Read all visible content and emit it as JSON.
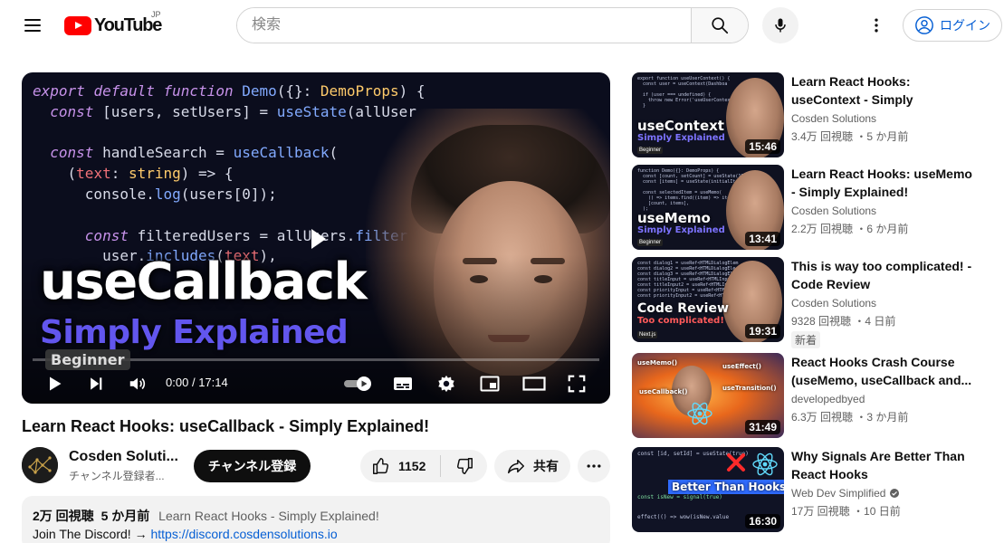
{
  "header": {
    "logo_text": "YouTube",
    "region": "JP",
    "search_placeholder": "検索",
    "login_label": "ログイン"
  },
  "player": {
    "thumbnail_title": "useCallback",
    "thumbnail_subtitle": "Simply Explained",
    "thumbnail_badge": "Beginner",
    "code_lines": [
      "export default function Demo({}: DemoProps) {",
      "  const [users, setUsers] = useState(allUser",
      "",
      "  const handleSearch = useCallback(",
      "    (text: string) => {",
      "      console.log(users[0]);",
      "",
      "      const filteredUsers = allUsers.filter",
      "        user.includes(text),"
    ],
    "time_current": "0:00",
    "time_separator": "/",
    "time_total": "17:14",
    "progress_fraction": 0.0
  },
  "video": {
    "title": "Learn React Hooks: useCallback - Simply Explained!",
    "channel_name": "Cosden Soluti...",
    "channel_subs": "チャンネル登録者...",
    "subscribe_label": "チャンネル登録",
    "like_count": "1152",
    "share_label": "共有"
  },
  "description": {
    "views": "2万 回視聴",
    "age": "5 か月前",
    "title_repeat": "Learn React Hooks - Simply Explained!",
    "line2_prefix": "Join The Discord! → ",
    "link": "https://discord.cosdensolutions.io"
  },
  "sidebar": [
    {
      "title": "Learn React Hooks: useContext - Simply Explained!",
      "channel": "Cosden Solutions",
      "stats": "3.4万 回視聴 ・5 か月前",
      "duration": "15:46",
      "thumb_title": "useContext",
      "thumb_sub": "Simply Explained",
      "thumb_badge": "Beginner",
      "verified": false,
      "badge": ""
    },
    {
      "title": "Learn React Hooks: useMemo - Simply Explained!",
      "channel": "Cosden Solutions",
      "stats": "2.2万 回視聴 ・6 か月前",
      "duration": "13:41",
      "thumb_title": "useMemo",
      "thumb_sub": "Simply Explained",
      "thumb_badge": "Beginner",
      "verified": false,
      "badge": ""
    },
    {
      "title": "This is way too complicated! - Code Review",
      "channel": "Cosden Solutions",
      "stats": "9328 回視聴 ・4 日前",
      "duration": "19:31",
      "thumb_title": "Code Review",
      "thumb_sub": "Too complicated!",
      "thumb_badge": "Next.js",
      "verified": false,
      "badge": "新着"
    },
    {
      "title": "React Hooks Crash Course (useMemo, useCallback and...",
      "channel": "developedbyed",
      "stats": "6.3万 回視聴 ・3 か月前",
      "duration": "31:49",
      "thumb_labels": [
        "useMemo()",
        "useEffect()",
        "useCallback()",
        "useTransition()"
      ],
      "verified": false,
      "badge": ""
    },
    {
      "title": "Why Signals Are Better Than React Hooks",
      "channel": "Web Dev Simplified",
      "stats": "17万 回視聴 ・10 日前",
      "duration": "16:30",
      "thumb_title": "Better Than Hooks",
      "thumb_code_top": "const [id, setId] = useState(true)",
      "thumb_code_mid": "const isNew = signal(true)",
      "thumb_code_bot": "effect(() => wow(isNew.value",
      "verified": true,
      "badge": ""
    }
  ],
  "colors": {
    "brand_red": "#ff0000",
    "link_blue": "#065fd4",
    "thumb_purple": "#6256ee",
    "subscribe_bg": "#0f0f0f"
  }
}
